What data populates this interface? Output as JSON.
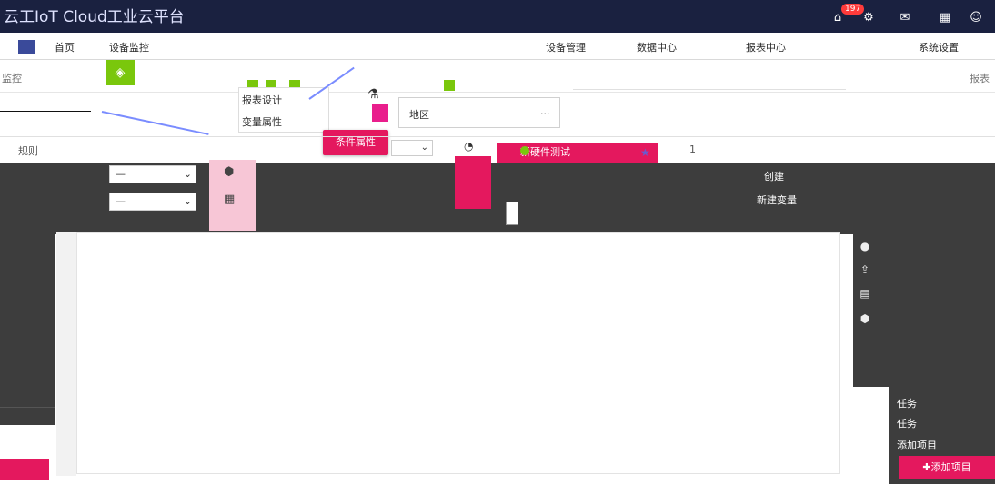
{
  "window": {
    "title": "云工IoT Cloud工业云平台"
  },
  "topbar": {
    "badge_count": "197",
    "icons": [
      "home-icon",
      "settings-icon",
      "mail-icon",
      "grid-icon",
      "user-icon"
    ]
  },
  "navbar": {
    "links": [
      "首页",
      "设备监控",
      "设备管理",
      "数据中心",
      "报表中心",
      "系统设置"
    ]
  },
  "subbar": {
    "monitor_label": "监控",
    "report_label": "报表"
  },
  "dropdown": {
    "items": [
      "报表设计",
      "变量属性"
    ]
  },
  "region_panel": {
    "label": "地区",
    "more": "..."
  },
  "condition_button": {
    "label": "条件属性"
  },
  "new_hardware": {
    "label": "新硬件测试"
  },
  "tabs": {
    "rule": "规则",
    "number": "1"
  },
  "right_labels": {
    "row1": "创建",
    "row2": "新建变量"
  },
  "right_panel": {
    "rows": [
      "任务",
      "任务",
      "添加项目"
    ],
    "add_button": "✚添加项目"
  },
  "left_panel": {
    "ellipsis": "...."
  },
  "colors": {
    "topbar": "#1a2140",
    "accent_pink": "#e4185e",
    "accent_green": "#7ac70c",
    "dark_panel": "#3d3d3d"
  }
}
